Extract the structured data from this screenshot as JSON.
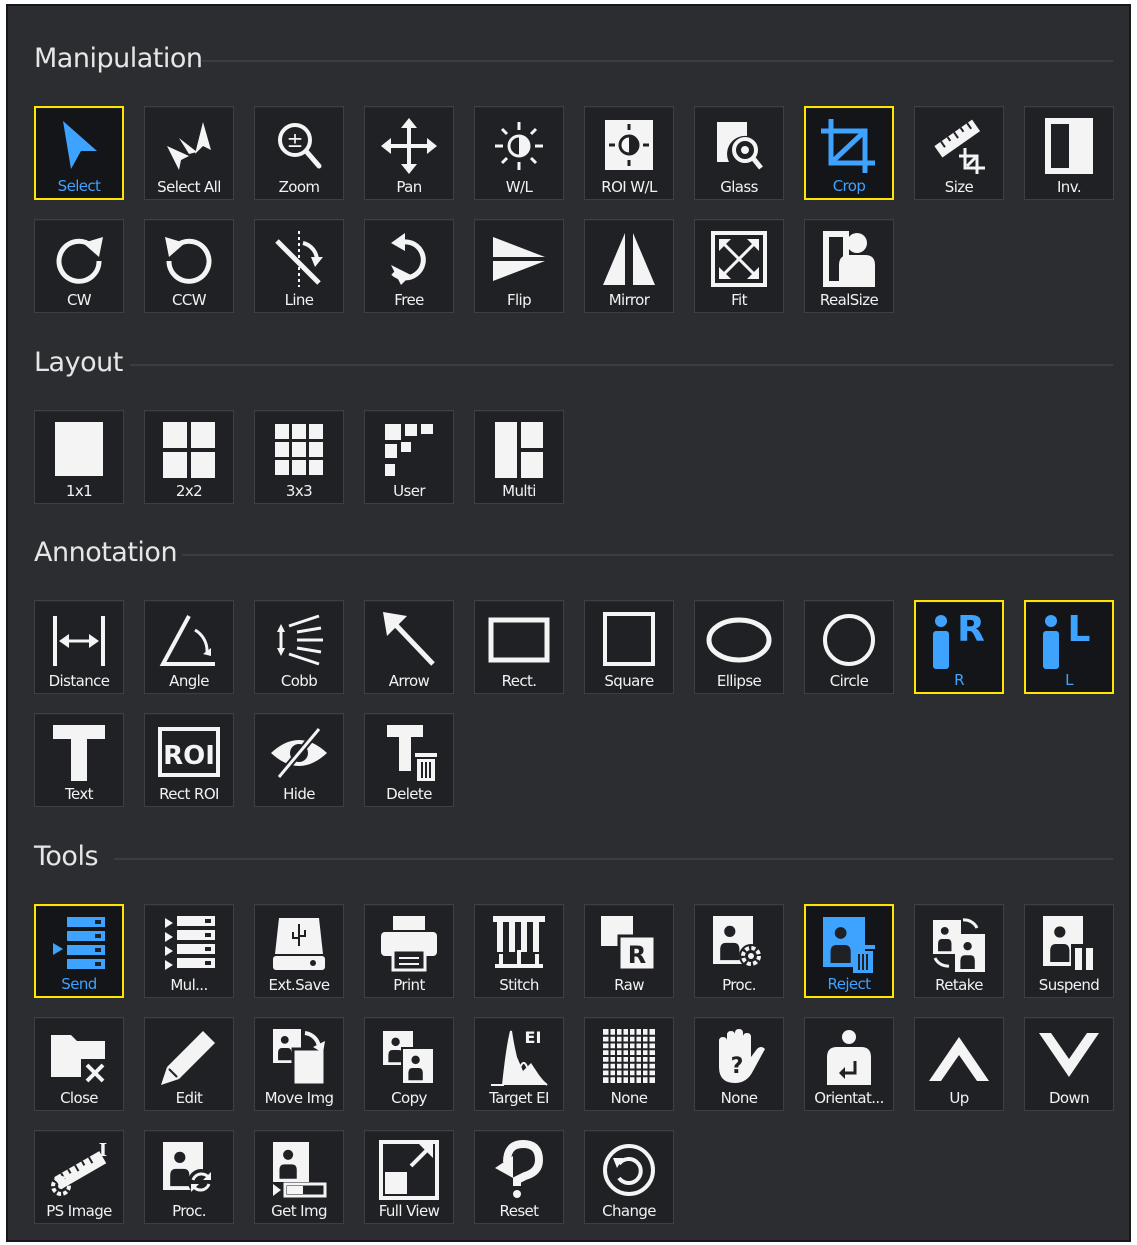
{
  "sections": [
    {
      "title": "Manipulation",
      "buttons": [
        {
          "label": "Select",
          "icon": "cursor-arrow",
          "active": true
        },
        {
          "label": "Select All",
          "icon": "multi-cursor"
        },
        {
          "label": "Zoom",
          "icon": "zoom"
        },
        {
          "label": "Pan",
          "icon": "pan"
        },
        {
          "label": "W/L",
          "icon": "window-level"
        },
        {
          "label": "ROI W/L",
          "icon": "roi-window-level"
        },
        {
          "label": "Glass",
          "icon": "magnifier-glass"
        },
        {
          "label": "Crop",
          "icon": "crop",
          "active": true
        },
        {
          "label": "Size",
          "icon": "ruler-size"
        },
        {
          "label": "Inv.",
          "icon": "invert"
        },
        {
          "label": "CW",
          "icon": "rotate-cw"
        },
        {
          "label": "CCW",
          "icon": "rotate-ccw"
        },
        {
          "label": "Line",
          "icon": "rotate-line"
        },
        {
          "label": "Free",
          "icon": "rotate-free"
        },
        {
          "label": "Flip",
          "icon": "flip"
        },
        {
          "label": "Mirror",
          "icon": "mirror"
        },
        {
          "label": "Fit",
          "icon": "fit"
        },
        {
          "label": "RealSize",
          "icon": "real-size"
        }
      ]
    },
    {
      "title": "Layout",
      "buttons": [
        {
          "label": "1x1",
          "icon": "layout-1x1"
        },
        {
          "label": "2x2",
          "icon": "layout-2x2"
        },
        {
          "label": "3x3",
          "icon": "layout-3x3"
        },
        {
          "label": "User",
          "icon": "layout-user"
        },
        {
          "label": "Multi",
          "icon": "layout-multi"
        }
      ]
    },
    {
      "title": "Annotation",
      "buttons": [
        {
          "label": "Distance",
          "icon": "distance"
        },
        {
          "label": "Angle",
          "icon": "angle"
        },
        {
          "label": "Cobb",
          "icon": "cobb"
        },
        {
          "label": "Arrow",
          "icon": "arrow"
        },
        {
          "label": "Rect.",
          "icon": "rectangle"
        },
        {
          "label": "Square",
          "icon": "square"
        },
        {
          "label": "Ellipse",
          "icon": "ellipse"
        },
        {
          "label": "Circle",
          "icon": "circle"
        },
        {
          "label": "R",
          "icon": "marker-right",
          "active": true
        },
        {
          "label": "L",
          "icon": "marker-left",
          "active": true
        },
        {
          "label": "Text",
          "icon": "text"
        },
        {
          "label": "Rect ROI",
          "icon": "rect-roi"
        },
        {
          "label": "Hide",
          "icon": "hide-eye"
        },
        {
          "label": "Delete",
          "icon": "delete-text"
        }
      ]
    },
    {
      "title": "Tools",
      "buttons": [
        {
          "label": "Send",
          "icon": "send-list",
          "active": true
        },
        {
          "label": "Mul...",
          "icon": "multi-send"
        },
        {
          "label": "Ext.Save",
          "icon": "usb-drive"
        },
        {
          "label": "Print",
          "icon": "printer"
        },
        {
          "label": "Stitch",
          "icon": "stitch"
        },
        {
          "label": "Raw",
          "icon": "raw"
        },
        {
          "label": "Proc.",
          "icon": "process-gear"
        },
        {
          "label": "Reject",
          "icon": "reject",
          "active": true
        },
        {
          "label": "Retake",
          "icon": "retake"
        },
        {
          "label": "Suspend",
          "icon": "suspend"
        },
        {
          "label": "Close",
          "icon": "close-folder"
        },
        {
          "label": "Edit",
          "icon": "pencil"
        },
        {
          "label": "Move Img",
          "icon": "move-image"
        },
        {
          "label": "Copy",
          "icon": "copy-image"
        },
        {
          "label": "Target EI",
          "icon": "target-ei"
        },
        {
          "label": "None",
          "icon": "grid-none"
        },
        {
          "label": "None",
          "icon": "hand-question"
        },
        {
          "label": "Orientat...",
          "icon": "orientation"
        },
        {
          "label": "Up",
          "icon": "chevron-up"
        },
        {
          "label": "Down",
          "icon": "chevron-down"
        },
        {
          "label": "PS Image",
          "icon": "ps-image"
        },
        {
          "label": "Proc.",
          "icon": "process-refresh"
        },
        {
          "label": "Get Img",
          "icon": "get-image"
        },
        {
          "label": "Full View",
          "icon": "full-view"
        },
        {
          "label": "Reset",
          "icon": "reset"
        },
        {
          "label": "Change",
          "icon": "change"
        }
      ]
    }
  ],
  "element_text": {
    "eI": "EI",
    "ROI": "ROI",
    "R": "R",
    "L": "L",
    "I": "I"
  },
  "colors": {
    "accent": "#3ea2ff",
    "active_border": "#ffe400",
    "panel": "#2b2d31"
  }
}
